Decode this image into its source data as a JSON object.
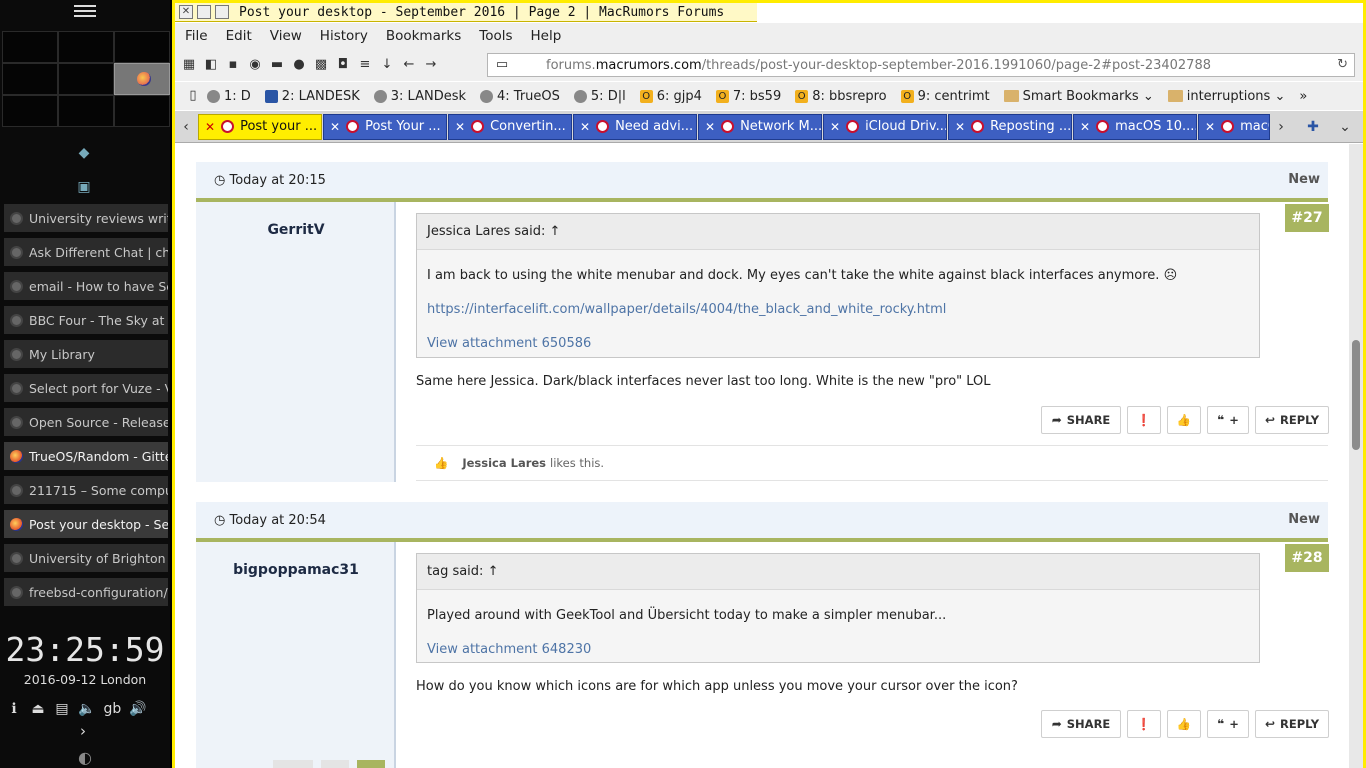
{
  "taskbar": {
    "tasks": [
      {
        "label": "University reviews writ",
        "icon": "app-circle"
      },
      {
        "label": "Ask Different Chat | ch",
        "icon": "app-circle"
      },
      {
        "label": "email - How to have Se",
        "icon": "app-circle"
      },
      {
        "label": "BBC Four - The Sky at N",
        "icon": "app-circle"
      },
      {
        "label": "My Library",
        "icon": "app-circle"
      },
      {
        "label": "Select port for Vuze - V",
        "icon": "app-circle"
      },
      {
        "label": "Open Source - Release",
        "icon": "app-circle"
      },
      {
        "label": "TrueOS/Random - Gitte",
        "icon": "firefox"
      },
      {
        "label": "211715 – Some compu",
        "icon": "app-circle"
      },
      {
        "label": "Post your desktop - Se",
        "icon": "firefox"
      },
      {
        "label": "University of Brighton",
        "icon": "app-circle"
      },
      {
        "label": "freebsd-configuration/",
        "icon": "app-circle"
      }
    ],
    "clock": "23:25:59",
    "date": "2016-09-12 London",
    "tray": {
      "keyboard_layout": "gb"
    }
  },
  "window": {
    "title": "Post your desktop - September 2016 | Page 2 | MacRumors Forums",
    "menus": [
      "File",
      "Edit",
      "View",
      "History",
      "Bookmarks",
      "Tools",
      "Help"
    ],
    "url_prefix": "forums.",
    "url_domain": "macrumors.com",
    "url_path": "/threads/post-your-desktop-september-2016.1991060/page-2#post-23402788",
    "bookmarks": [
      {
        "label": "1: D",
        "icon": "globe"
      },
      {
        "label": "2: LANDESK",
        "icon": "tool"
      },
      {
        "label": "3: LANDesk",
        "icon": "globe"
      },
      {
        "label": "4: TrueOS",
        "icon": "globe"
      },
      {
        "label": "5: D|l",
        "icon": "globe"
      },
      {
        "label": "6: gjp4",
        "icon": "o"
      },
      {
        "label": "7: bs59",
        "icon": "o"
      },
      {
        "label": "8: bbsrepro",
        "icon": "o"
      },
      {
        "label": "9: centrimt",
        "icon": "o"
      },
      {
        "label": "Smart Bookmarks",
        "icon": "folder"
      },
      {
        "label": "interruptions",
        "icon": "folder"
      }
    ],
    "tabs": [
      {
        "label": "Post your ...",
        "active": true
      },
      {
        "label": "Post Your ...",
        "active": false
      },
      {
        "label": "Convertin...",
        "active": false
      },
      {
        "label": "Need advi...",
        "active": false
      },
      {
        "label": "Network M...",
        "active": false
      },
      {
        "label": "iCloud Driv...",
        "active": false
      },
      {
        "label": "Reposting ...",
        "active": false
      },
      {
        "label": "macOS 10....",
        "active": false
      },
      {
        "label": "macOS",
        "active": false
      }
    ]
  },
  "posts": [
    {
      "time": "Today at 20:15",
      "new_label": "New",
      "author": "GerritV",
      "number": "#27",
      "quote_author": "Jessica Lares said: ↑",
      "quote_lines": [
        "I am back to using the white menubar and dock. My eyes can't take the white against black interfaces anymore. ☹",
        "https://interfacelift.com/wallpaper/details/4004/the_black_and_white_rocky.html",
        "View attachment 650586"
      ],
      "text": "Same here Jessica. Dark/black interfaces never last too long. White is the new \"pro\" LOL",
      "likes_user": "Jessica Lares",
      "likes_suffix": "likes this."
    },
    {
      "time": "Today at 20:54",
      "new_label": "New",
      "author": "bigpoppamac31",
      "number": "#28",
      "quote_author": "tag said: ↑",
      "quote_lines": [
        "Played around with GeekTool and Übersicht today to make a simpler menubar...",
        "View attachment 648230"
      ],
      "text": "How do you know which icons are for which app unless you move your cursor over the icon?"
    }
  ],
  "actions": {
    "share": "SHARE",
    "reply": "REPLY",
    "quote_plus": "+"
  },
  "colors": {
    "window_border": "#ffec00",
    "active_tab": "#ffee00",
    "inactive_tab": "#3d5fc2",
    "post_accent": "#a8b560",
    "link": "#4e74a6"
  }
}
